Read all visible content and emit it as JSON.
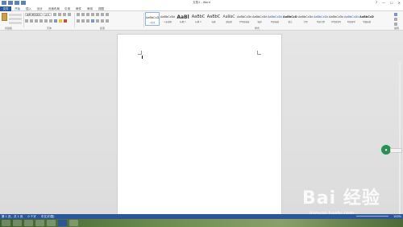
{
  "window": {
    "title": "文档1 - Word",
    "controls": [
      "?",
      "—",
      "☐",
      "✕"
    ]
  },
  "tabs": [
    "文件",
    "开始",
    "插入",
    "设计",
    "页面布局",
    "引用",
    "邮件",
    "审阅",
    "视图"
  ],
  "ribbon": {
    "font_name": "宋体 (中文正文)",
    "font_size": "五号",
    "groups": [
      "剪贴板",
      "字体",
      "段落",
      "样式",
      "编辑"
    ]
  },
  "styles": [
    {
      "sample": "AaBbCcDd",
      "label": "↵正文"
    },
    {
      "sample": "AaBbCcDd",
      "label": "↵无间隔"
    },
    {
      "sample": "AaBl",
      "label": "标题 1"
    },
    {
      "sample": "AaBbC",
      "label": "标题 2"
    },
    {
      "sample": "AaBbC",
      "label": "标题"
    },
    {
      "sample": "AaBbC",
      "label": "副标题"
    },
    {
      "sample": "AaBbCcDd",
      "label": "不明显强调"
    },
    {
      "sample": "AaBbCcDd",
      "label": "强调"
    },
    {
      "sample": "AaBbCcDd",
      "label": "明显强调"
    },
    {
      "sample": "AaBbCcDd",
      "label": "要点"
    },
    {
      "sample": "AaBbCcDd",
      "label": "引用"
    },
    {
      "sample": "AaBbCcDd",
      "label": "明显引用"
    },
    {
      "sample": "AaBbCcDd",
      "label": "不明显参考"
    },
    {
      "sample": "AaBbCcDd",
      "label": "明显参考"
    },
    {
      "sample": "AaBbCcDd",
      "label": "书籍标题"
    }
  ],
  "statusbar": {
    "page": "第 1 页，共 1 页",
    "words": "0 个字",
    "language": "中文(中国)",
    "zoom": "100%"
  },
  "watermark": {
    "brand": "Bai 经验",
    "url": "jingyan.baidu.com"
  },
  "colors": {
    "accent": "#2b579a",
    "ribbon_bg": "#f7f7f7",
    "document_bg": "#e6e6e6"
  }
}
